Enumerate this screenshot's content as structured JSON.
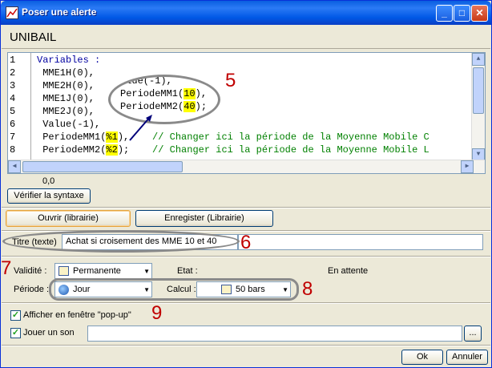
{
  "window": {
    "title": "Poser une alerte",
    "stock_name": "UNIBAIL"
  },
  "editor": {
    "lines": [
      {
        "num": "1",
        "text": "Variables :"
      },
      {
        "num": "2",
        "text": " MME1H(0),"
      },
      {
        "num": "3",
        "text": " MME2H(0),"
      },
      {
        "num": "4",
        "text": " MME1J(0),"
      },
      {
        "num": "5",
        "text": " MME2J(0),"
      },
      {
        "num": "6",
        "text": " Value(-1),"
      },
      {
        "num": "7",
        "code": " PeriodeMM1(",
        "param": "%1",
        "end": "),",
        "comment": "    // Changer ici la période de la Moyenne Mobile C"
      },
      {
        "num": "8",
        "code": " PeriodeMM2(",
        "param": "%2",
        "end": ");",
        "comment": "    // Changer ici la période de la Moyenne Mobile L"
      }
    ],
    "zoom_lines": [
      {
        "text": "alue(-1),"
      },
      {
        "code": "PeriodeMM1(",
        "param": "10",
        "end": "),"
      },
      {
        "code": "PeriodeMM2(",
        "param": "40",
        "end": ");"
      }
    ],
    "cursor_pos": "0,0"
  },
  "buttons": {
    "verify_syntax": "Vérifier la syntaxe",
    "open_library": "Ouvrir (librairie)",
    "save_library": "Enregister (Librairie)",
    "ok": "Ok",
    "cancel": "Annuler",
    "browse": "..."
  },
  "form": {
    "title_label": "Titre (texte)",
    "title_value": "Achat si croisement des MME 10 et 40",
    "validity_label": "Validité :",
    "validity_value": "Permanente",
    "state_label": "Etat :",
    "state_value": "En attente",
    "period_label": "Période :",
    "period_value": "Jour",
    "calc_label": "Calcul :",
    "calc_value": "50 bars",
    "popup_label": "Afficher en fenêtre \"pop-up\"",
    "popup_checked": true,
    "sound_label": "Jouer un son",
    "sound_checked": true,
    "sound_path": ""
  },
  "annotations": {
    "n5": "5",
    "n6": "6",
    "n7": "7",
    "n8": "8",
    "n9": "9"
  }
}
